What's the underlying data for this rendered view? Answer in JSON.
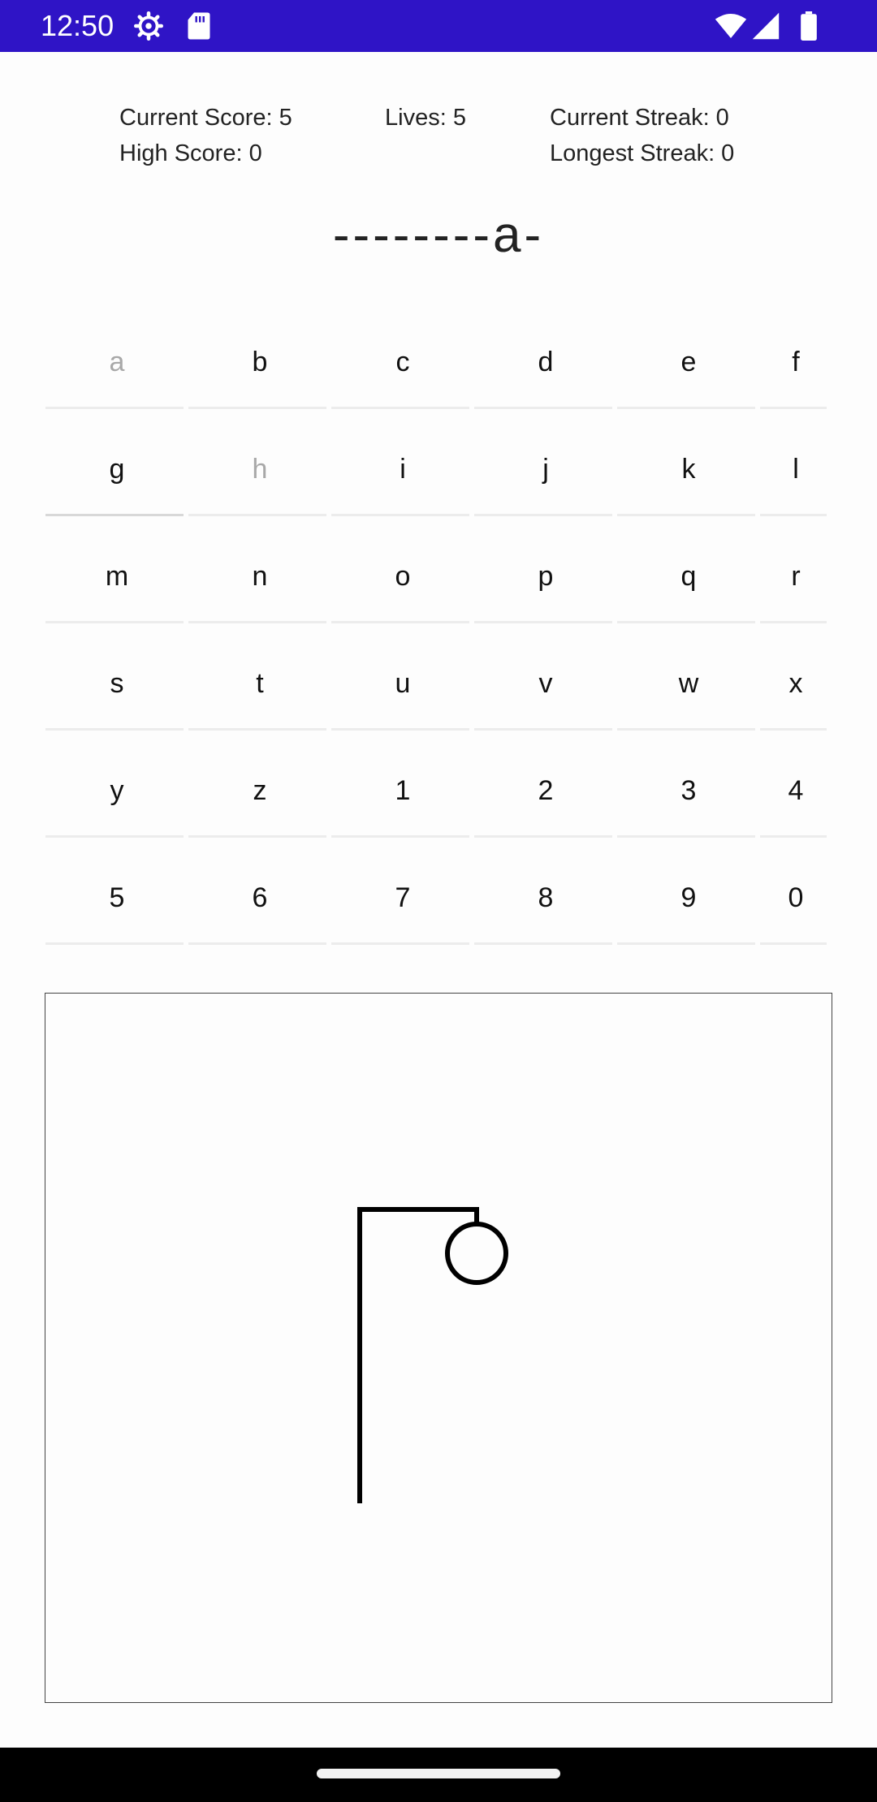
{
  "status_bar": {
    "time": "12:50",
    "icons": [
      "gear-icon",
      "sd-card-icon",
      "wifi-icon",
      "signal-icon",
      "battery-icon"
    ],
    "color": "#2f14c6"
  },
  "stats": {
    "current_score": "Current Score: 5",
    "high_score": "High Score: 0",
    "lives": "Lives: 5",
    "current_streak": "Current Streak: 0",
    "longest_streak": "Longest Streak: 0"
  },
  "word": "--------a-",
  "keyboard": {
    "rows": [
      [
        {
          "label": "a",
          "used": true
        },
        {
          "label": "b",
          "used": false
        },
        {
          "label": "c",
          "used": false
        },
        {
          "label": "d",
          "used": false
        },
        {
          "label": "e",
          "used": false
        },
        {
          "label": "f",
          "used": false
        }
      ],
      [
        {
          "label": "g",
          "used": false
        },
        {
          "label": "h",
          "used": true
        },
        {
          "label": "i",
          "used": false
        },
        {
          "label": "j",
          "used": false
        },
        {
          "label": "k",
          "used": false
        },
        {
          "label": "l",
          "used": false
        }
      ],
      [
        {
          "label": "m",
          "used": false
        },
        {
          "label": "n",
          "used": false
        },
        {
          "label": "o",
          "used": false
        },
        {
          "label": "p",
          "used": false
        },
        {
          "label": "q",
          "used": false
        },
        {
          "label": "r",
          "used": false
        }
      ],
      [
        {
          "label": "s",
          "used": false
        },
        {
          "label": "t",
          "used": false
        },
        {
          "label": "u",
          "used": false
        },
        {
          "label": "v",
          "used": false
        },
        {
          "label": "w",
          "used": false
        },
        {
          "label": "x",
          "used": false
        }
      ],
      [
        {
          "label": "y",
          "used": false
        },
        {
          "label": "z",
          "used": false
        },
        {
          "label": "1",
          "used": false
        },
        {
          "label": "2",
          "used": false
        },
        {
          "label": "3",
          "used": false
        },
        {
          "label": "4",
          "used": false
        }
      ],
      [
        {
          "label": "5",
          "used": false
        },
        {
          "label": "6",
          "used": false
        },
        {
          "label": "7",
          "used": false
        },
        {
          "label": "8",
          "used": false
        },
        {
          "label": "9",
          "used": false
        },
        {
          "label": "0",
          "used": false
        }
      ]
    ]
  },
  "hangman": {
    "parts_drawn": [
      "pole",
      "beam",
      "rope",
      "head"
    ]
  }
}
